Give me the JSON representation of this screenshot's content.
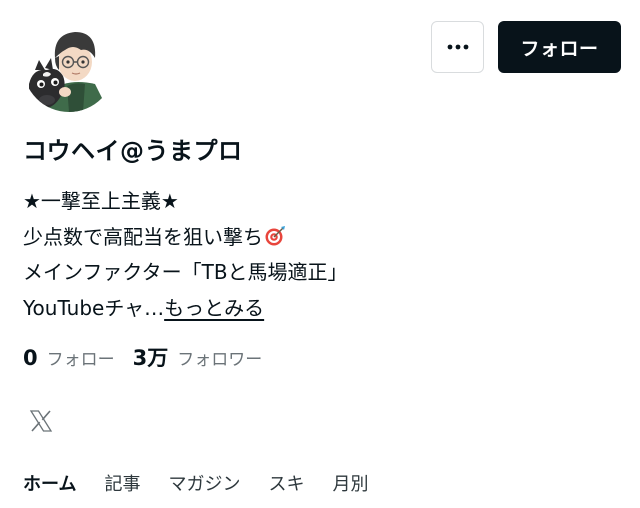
{
  "profile": {
    "display_name": "コウヘイ@うまプロ",
    "avatar_icon": "user-avatar-illustration"
  },
  "header": {
    "more_icon": "more-dots-icon",
    "follow_label": "フォロー"
  },
  "bio": {
    "line1": "★一撃至上主義★",
    "line2": "少点数で高配当を狙い撃ち",
    "line2_icon": "target-dart-icon",
    "line3": "メインファクター「TBと馬場適正」",
    "line4_truncated": "YouTubeチャ…",
    "more_link": "もっとみる"
  },
  "stats": {
    "following_count": "0",
    "following_label": "フォロー",
    "followers_count": "3万",
    "followers_label": "フォロワー"
  },
  "social": {
    "x_icon": "x-logo-icon"
  },
  "tabs": [
    {
      "label": "ホーム",
      "active": true
    },
    {
      "label": "記事",
      "active": false
    },
    {
      "label": "マガジン",
      "active": false
    },
    {
      "label": "スキ",
      "active": false
    },
    {
      "label": "月別",
      "active": false
    }
  ],
  "colors": {
    "text": "#08131a",
    "muted": "#6b7378",
    "button_dark": "#08131a",
    "border": "#d9dcde"
  }
}
